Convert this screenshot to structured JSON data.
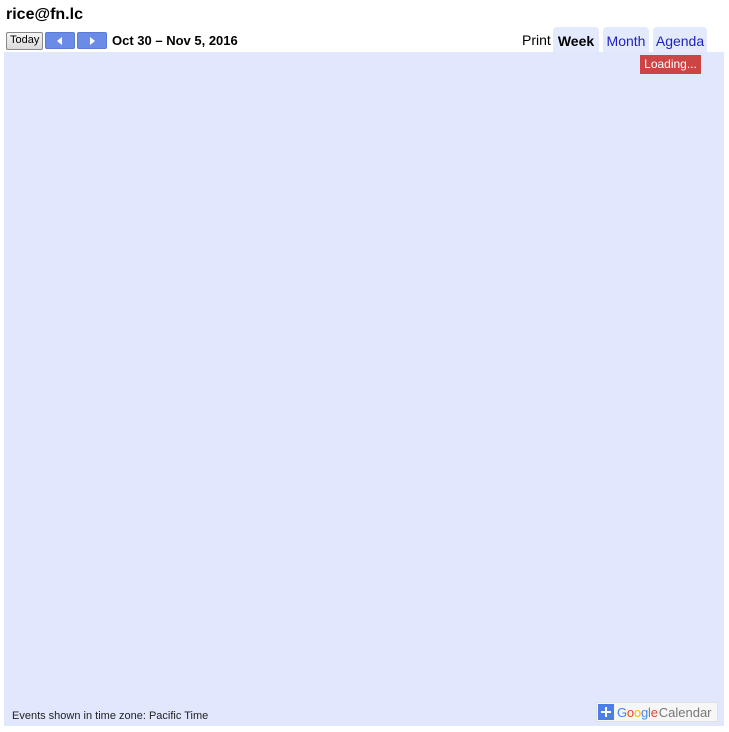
{
  "header": {
    "title": "rice@fn.lc",
    "today_label": "Today",
    "date_range": "Oct 30 – Nov 5, 2016"
  },
  "views": {
    "print_label": "Print",
    "tabs": [
      {
        "label": "Week",
        "active": true
      },
      {
        "label": "Month",
        "active": false
      },
      {
        "label": "Agenda",
        "active": false
      }
    ]
  },
  "status": {
    "loading": "Loading..."
  },
  "footer": {
    "timezone_note": "Events shown in time zone: Pacific Time",
    "badge_google": [
      "G",
      "o",
      "o",
      "g",
      "l",
      "e"
    ],
    "badge_calendar": "Calendar"
  },
  "colors": {
    "grid_bg": "#e1e8fd",
    "tab_bg": "#e4eafd",
    "nav_button": "#6b8ce6",
    "loading_bg": "#cc4444",
    "link": "#2020c0"
  },
  "icons": {
    "prev": "chevron-left-icon",
    "next": "chevron-right-icon",
    "add": "plus-icon"
  }
}
